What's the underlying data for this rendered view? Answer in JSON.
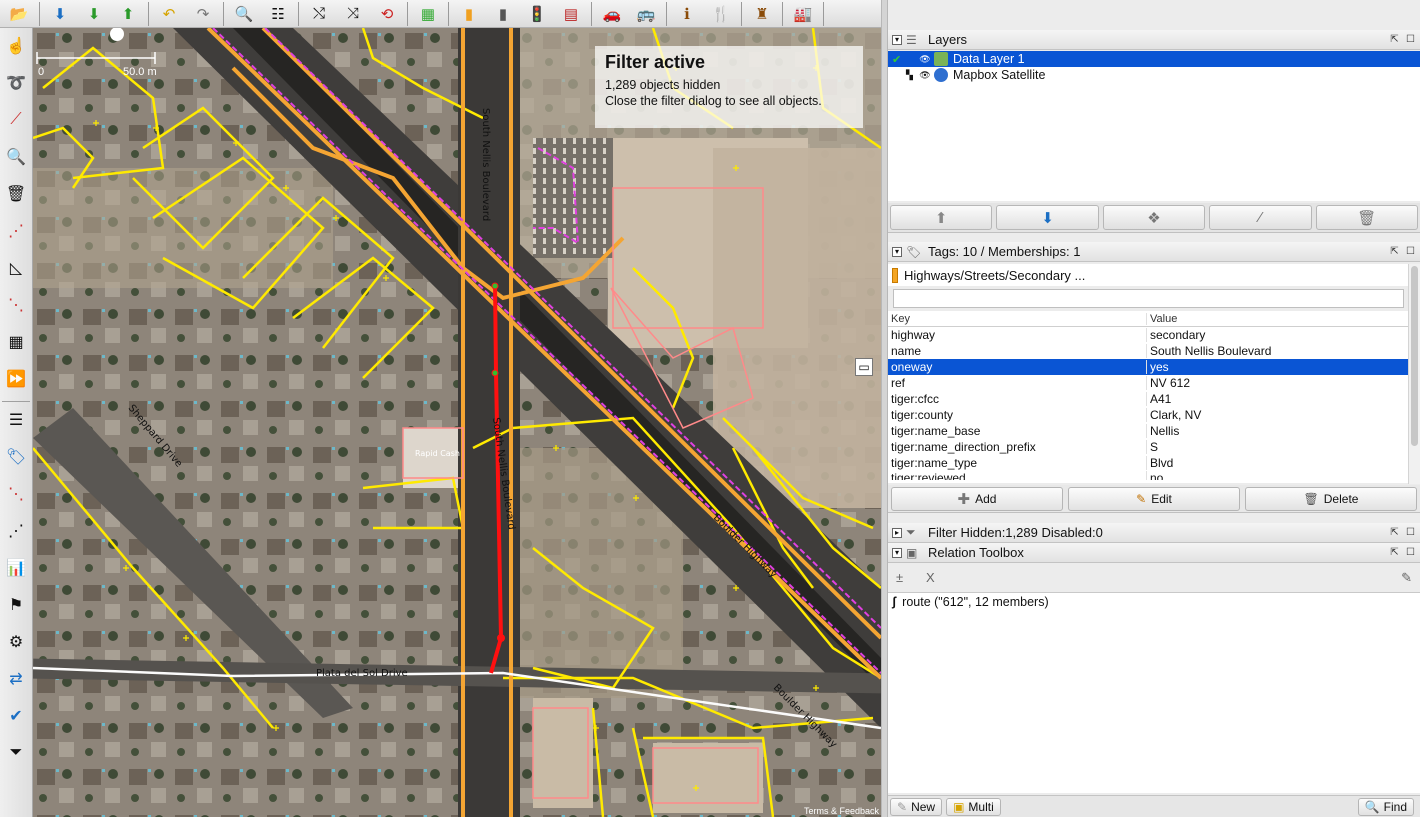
{
  "map": {
    "scale_start": "0",
    "scale_end": "50.0 m",
    "filter_title": "Filter active",
    "filter_line1": "1,289 objects hidden",
    "filter_line2": "Close the filter dialog to see all objects.",
    "attribution": "Terms & Feedback",
    "street_labels": [
      "South Nellis Boulevard",
      "South Nellis Boulevard",
      "Boulder Highway",
      "Boulder Highway",
      "Plata del Sol Drive",
      "Sheppard Drive",
      "Rapid Cash"
    ]
  },
  "layers": {
    "title": "Layers",
    "items": [
      {
        "name": "Data Layer 1",
        "selected": true
      },
      {
        "name": "Mapbox Satellite",
        "selected": false
      }
    ]
  },
  "tags": {
    "title": "Tags: 10 / Memberships: 1",
    "preset": "Highways/Streets/Secondary ...",
    "col_key": "Key",
    "col_value": "Value",
    "rows": [
      {
        "key": "highway",
        "value": "secondary"
      },
      {
        "key": "name",
        "value": "South Nellis Boulevard"
      },
      {
        "key": "oneway",
        "value": "yes"
      },
      {
        "key": "ref",
        "value": "NV 612"
      },
      {
        "key": "tiger:cfcc",
        "value": "A41"
      },
      {
        "key": "tiger:county",
        "value": "Clark, NV"
      },
      {
        "key": "tiger:name_base",
        "value": "Nellis"
      },
      {
        "key": "tiger:name_direction_prefix",
        "value": "S"
      },
      {
        "key": "tiger:name_type",
        "value": "Blvd"
      },
      {
        "key": "tiger:reviewed",
        "value": "no"
      }
    ],
    "selected_row": 2,
    "add_label": "Add",
    "edit_label": "Edit",
    "delete_label": "Delete"
  },
  "filter_panel": {
    "title": "Filter Hidden:1,289 Disabled:0"
  },
  "relation_toolbox": {
    "title": "Relation Toolbox",
    "tool_add": "±",
    "tool_x": "X",
    "items": [
      {
        "label": "route (\"612\", 12 members)"
      }
    ]
  },
  "bottom": {
    "new_label": "New",
    "multi_label": "Multi",
    "find_label": "Find"
  }
}
